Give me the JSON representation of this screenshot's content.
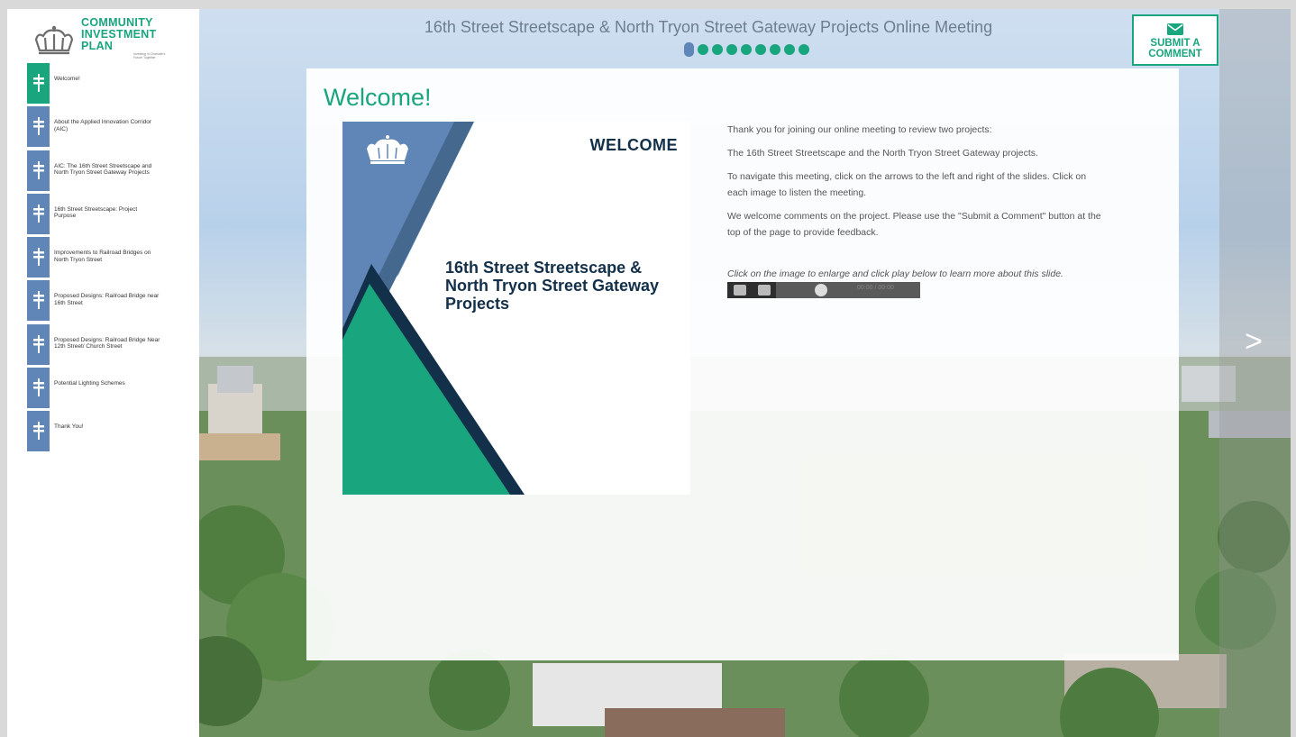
{
  "logo": {
    "line1": "COMMUNITY",
    "line2": "INVESTMENT",
    "line3": "PLAN",
    "tagline": "Investing in Charlotte's Future Together"
  },
  "header": {
    "title": "16th Street Streetscape & North Tryon Street Gateway Projects Online Meeting",
    "slide_count": 9,
    "current_slide": 1
  },
  "submit": {
    "line1": "SUBMIT A",
    "line2": "COMMENT",
    "icon": "envelope-icon"
  },
  "nav": {
    "items": [
      {
        "label": "Welcome!"
      },
      {
        "label": "About the Applied Innovation Corridor (AIC)"
      },
      {
        "label": "AIC: The 16th Street Streetscape and North Tryon Street Gateway Projects"
      },
      {
        "label": "16th Street Streetscape: Project Purpose"
      },
      {
        "label": "Improvements to Railroad Bridges on North Tryon Street"
      },
      {
        "label": "Proposed Designs: Railroad Bridge near 16th Street"
      },
      {
        "label": "Proposed Designs: Railroad Bridge Near 12th Street/ Church Street"
      },
      {
        "label": "Potential Lighting Schemes"
      },
      {
        "label": "Thank You!"
      }
    ]
  },
  "panel": {
    "title": "Welcome!",
    "slide_welcome": "WELCOME",
    "slide_heading": "16th Street Streetscape & North Tryon Street Gateway Projects",
    "paragraphs": [
      "Thank you for joining our online meeting to review two projects:",
      "The 16th Street Streetscape and the North Tryon Street Gateway projects.",
      "To navigate this meeting, click on the arrows to the left and right of the slides. Click on each image to listen the meeting.",
      "We welcome comments on the project. Please use the \"Submit a Comment\" button at the top of the page to provide feedback."
    ],
    "instruction": "Click on the image to enlarge and click play below to learn more about this slide.",
    "audio_time": "00:00 / 00:00"
  },
  "nav_arrow": ">",
  "colors": {
    "accent_green": "#19a57d",
    "nav_blue": "#5f86b6",
    "navy": "#12304a"
  }
}
